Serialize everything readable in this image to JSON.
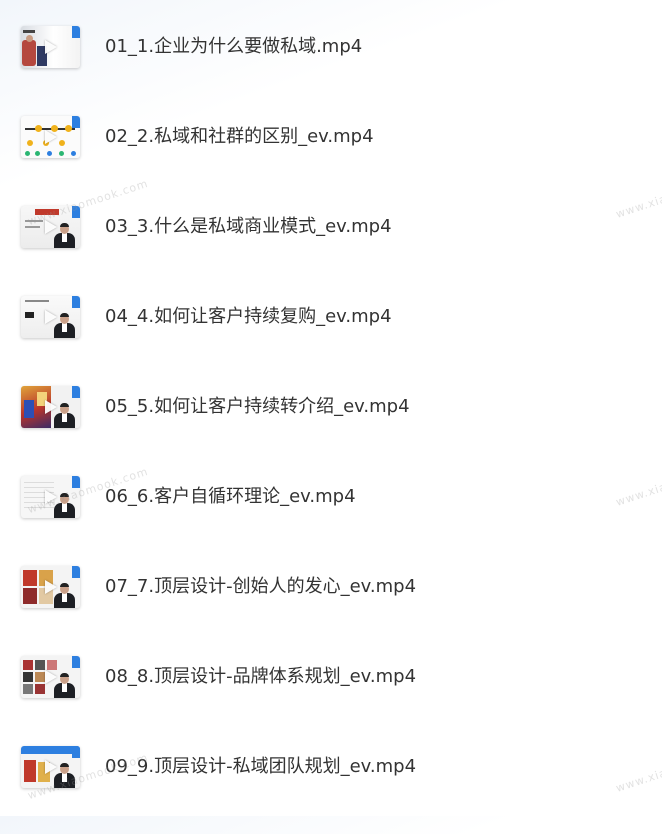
{
  "files": [
    {
      "name": "01_1.企业为什么要做私域.mp4",
      "thumb": {
        "icon": "video-thumbnail",
        "theme": "a"
      }
    },
    {
      "name": "02_2.私域和社群的区别_ev.mp4",
      "thumb": {
        "icon": "video-thumbnail",
        "theme": "b"
      }
    },
    {
      "name": "03_3.什么是私域商业模式_ev.mp4",
      "thumb": {
        "icon": "video-thumbnail",
        "theme": "c"
      }
    },
    {
      "name": "04_4.如何让客户持续复购_ev.mp4",
      "thumb": {
        "icon": "video-thumbnail",
        "theme": "d"
      }
    },
    {
      "name": "05_5.如何让客户持续转介绍_ev.mp4",
      "thumb": {
        "icon": "video-thumbnail",
        "theme": "e"
      }
    },
    {
      "name": "06_6.客户自循环理论_ev.mp4",
      "thumb": {
        "icon": "video-thumbnail",
        "theme": "f"
      }
    },
    {
      "name": "07_7.顶层设计-创始人的发心_ev.mp4",
      "thumb": {
        "icon": "video-thumbnail",
        "theme": "g"
      }
    },
    {
      "name": "08_8.顶层设计-品牌体系规划_ev.mp4",
      "thumb": {
        "icon": "video-thumbnail",
        "theme": "h"
      }
    },
    {
      "name": "09_9.顶层设计-私域团队规划_ev.mp4",
      "thumb": {
        "icon": "video-thumbnail",
        "theme": "i"
      }
    }
  ],
  "watermarks": [
    "www.xiaomook.com",
    "www.xia",
    "www.xiaomook.com",
    "www.xia",
    "www.xiaomook.com",
    "www.xia"
  ],
  "colors": {
    "text": "#333333",
    "accent": "#2d7fe0"
  }
}
